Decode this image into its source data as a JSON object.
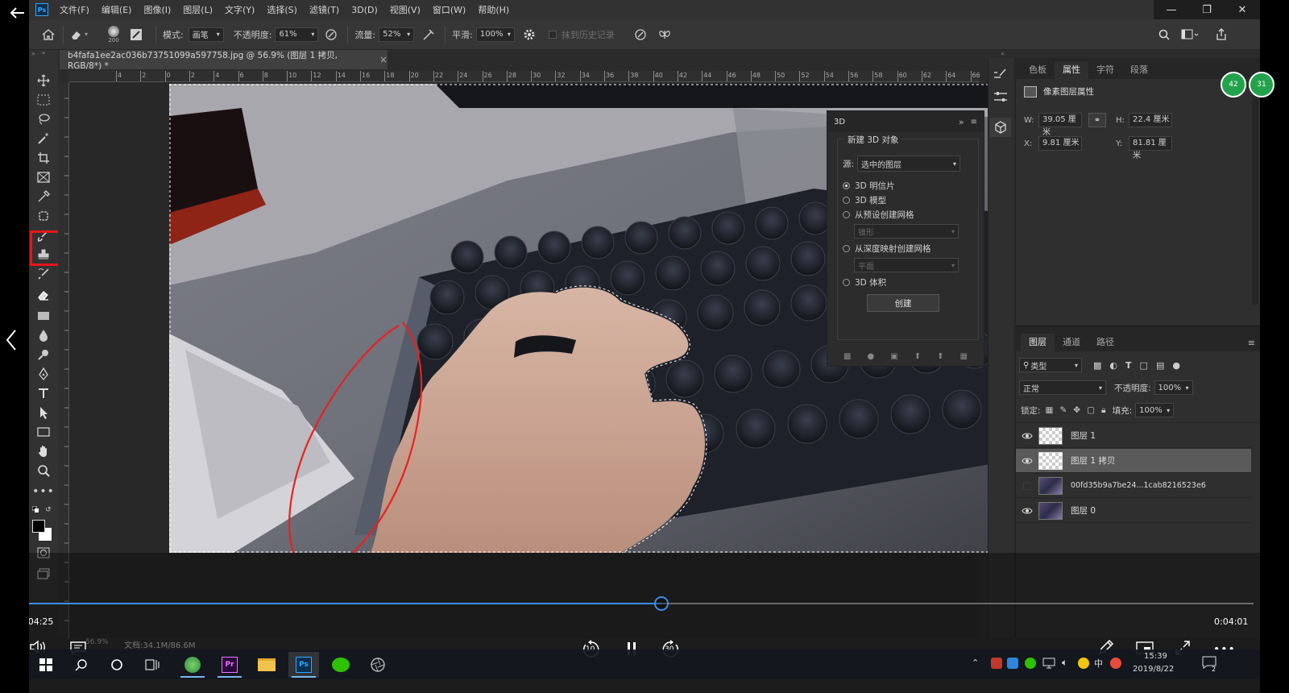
{
  "menubar": {
    "items": [
      "文件(F)",
      "编辑(E)",
      "图像(I)",
      "图层(L)",
      "文字(Y)",
      "选择(S)",
      "滤镜(T)",
      "3D(D)",
      "视图(V)",
      "窗口(W)",
      "帮助(H)"
    ]
  },
  "options": {
    "brush_size": "200",
    "mode_label": "模式:",
    "mode_value": "画笔",
    "opacity_label": "不透明度:",
    "opacity_value": "61%",
    "flow_label": "流量:",
    "flow_value": "52%",
    "smooth_label": "平滑:",
    "smooth_value": "100%",
    "history_label": "抹到历史记录"
  },
  "document": {
    "tab_title": "b4fafa1ee2ac036b73751099a597758.jpg @ 56.9% (图层 1 拷贝, RGB/8*) *",
    "close_glyph": "×",
    "ruler_top_ticks": [
      "4",
      "2",
      "0",
      "2",
      "4",
      "6",
      "8",
      "10",
      "12",
      "14",
      "16",
      "18",
      "20",
      "22",
      "24",
      "26",
      "28",
      "30",
      "32",
      "34",
      "36",
      "38",
      "40",
      "42",
      "44",
      "46",
      "48",
      "50",
      "52",
      "54",
      "56",
      "58",
      "60",
      "62",
      "64",
      "66"
    ],
    "status_zoom": "56.9%",
    "status_doc": "文档:34.1M/86.6M"
  },
  "panel3d": {
    "tab": "3D",
    "section_title": "新建 3D 对象",
    "source_label": "源:",
    "source_value": "选中的图层",
    "options": [
      "3D 明信片",
      "3D 模型",
      "从预设创建网格",
      "从深度映射创建网格",
      "3D 体积"
    ],
    "selected_option": "3D 明信片",
    "preset_value": "锥形",
    "depth_value": "平面",
    "create_button": "创建"
  },
  "properties": {
    "tabs": [
      "色板",
      "属性",
      "字符",
      "段落"
    ],
    "active_tab": "属性",
    "title": "像素图层属性",
    "w_label": "W:",
    "w_value": "39.05 厘米",
    "h_label": "H:",
    "h_value": "22.4 厘米",
    "x_label": "X:",
    "x_value": "9.81 厘米",
    "y_label": "Y:",
    "y_value": "81.81 厘米"
  },
  "layers": {
    "tabs": [
      "图层",
      "通道",
      "路径"
    ],
    "active_tab": "图层",
    "filter_value": "类型",
    "blend_mode": "正常",
    "opacity_label": "不透明度:",
    "opacity_value": "100%",
    "lock_label": "锁定:",
    "fill_label": "填充:",
    "fill_value": "100%",
    "items": [
      {
        "name": "图层 1",
        "visible": true,
        "selected": false
      },
      {
        "name": "图层 1 拷贝",
        "visible": true,
        "selected": true
      },
      {
        "name": "00fd35b9a7be24...1cab8216523e6",
        "visible": false,
        "selected": false
      },
      {
        "name": "图层 0",
        "visible": true,
        "selected": false
      }
    ]
  },
  "player": {
    "current_time": "0:04:25",
    "total_time": "0:04:01",
    "progress": 0.52,
    "rewind_label": "10",
    "forward_label": "30",
    "badge_left": "42",
    "badge_right": "31"
  },
  "taskbar": {
    "time": "15:39",
    "date": "2019/8/22",
    "ime": "中",
    "notifications": "2"
  },
  "colors": {
    "accent": "#3a8ee6",
    "highlight": "#e5161a",
    "panel": "#2f2f2f",
    "annotation": "#e8221f"
  }
}
